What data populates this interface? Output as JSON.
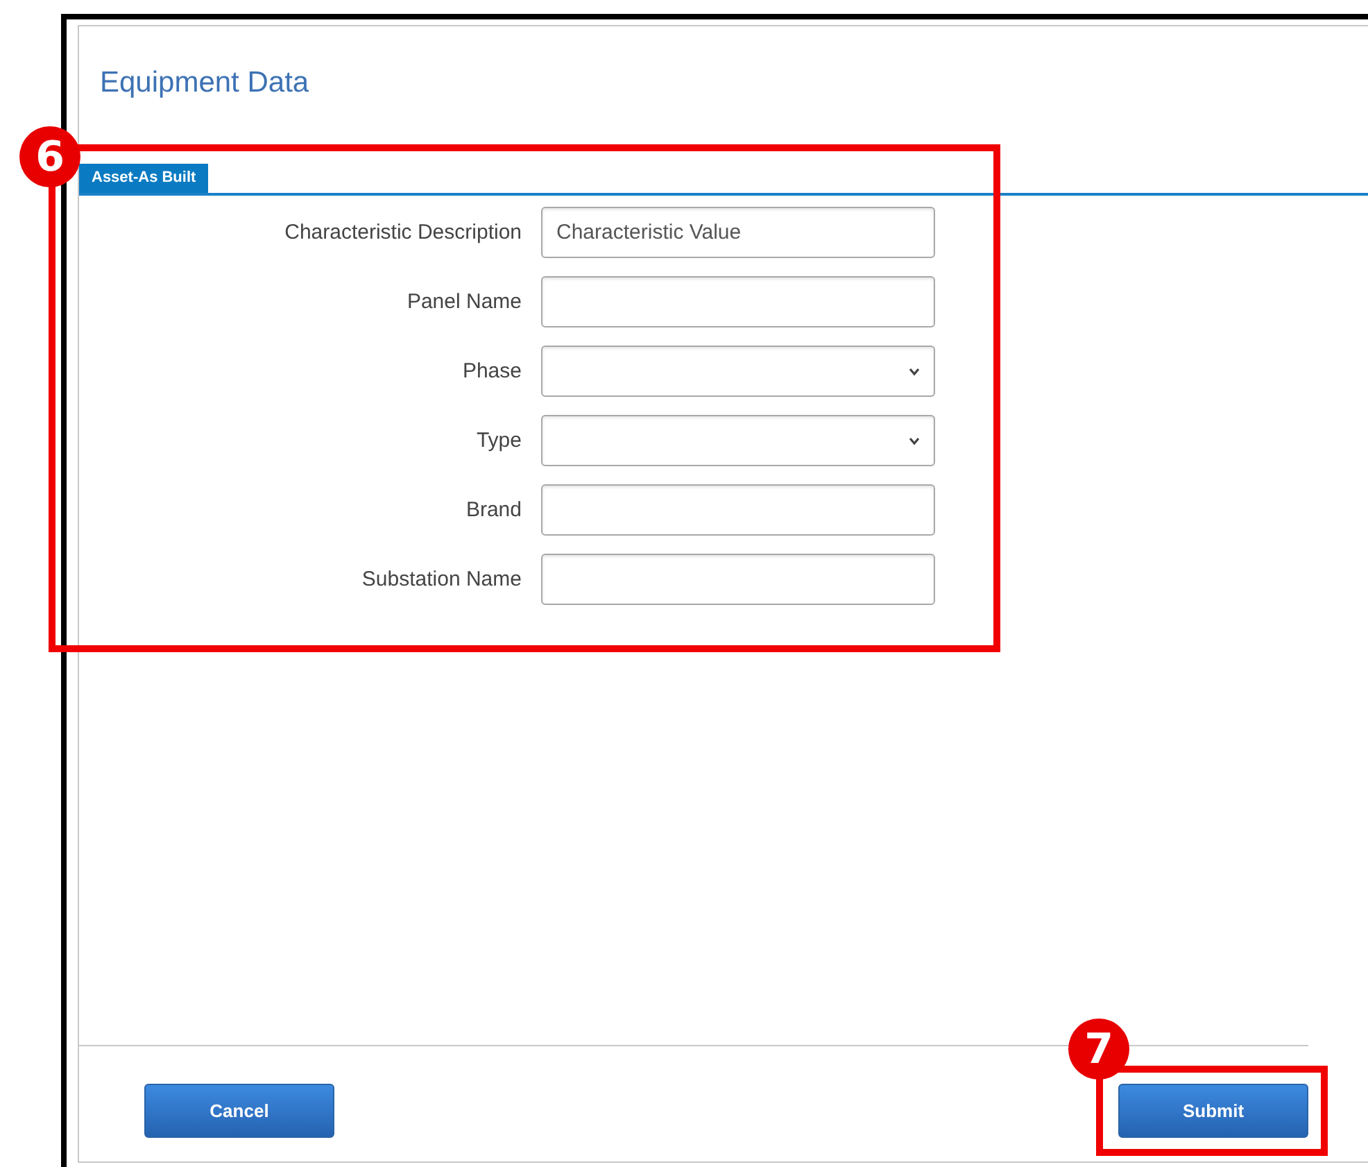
{
  "dialog": {
    "title": "Equipment Data"
  },
  "tabs": [
    {
      "label": "Asset-As Built",
      "selected": true
    }
  ],
  "fields": [
    {
      "label": "Characteristic Description",
      "kind": "text",
      "placeholder": "Characteristic Value"
    },
    {
      "label": "Panel Name",
      "kind": "text"
    },
    {
      "label": "Phase",
      "kind": "select"
    },
    {
      "label": "Type",
      "kind": "select"
    },
    {
      "label": "Brand",
      "kind": "text"
    },
    {
      "label": "Substation Name",
      "kind": "text"
    }
  ],
  "buttons": [
    {
      "label": "Cancel"
    },
    {
      "label": "Submit"
    }
  ],
  "annotations": [
    {
      "number": "6"
    },
    {
      "number": "7"
    }
  ]
}
